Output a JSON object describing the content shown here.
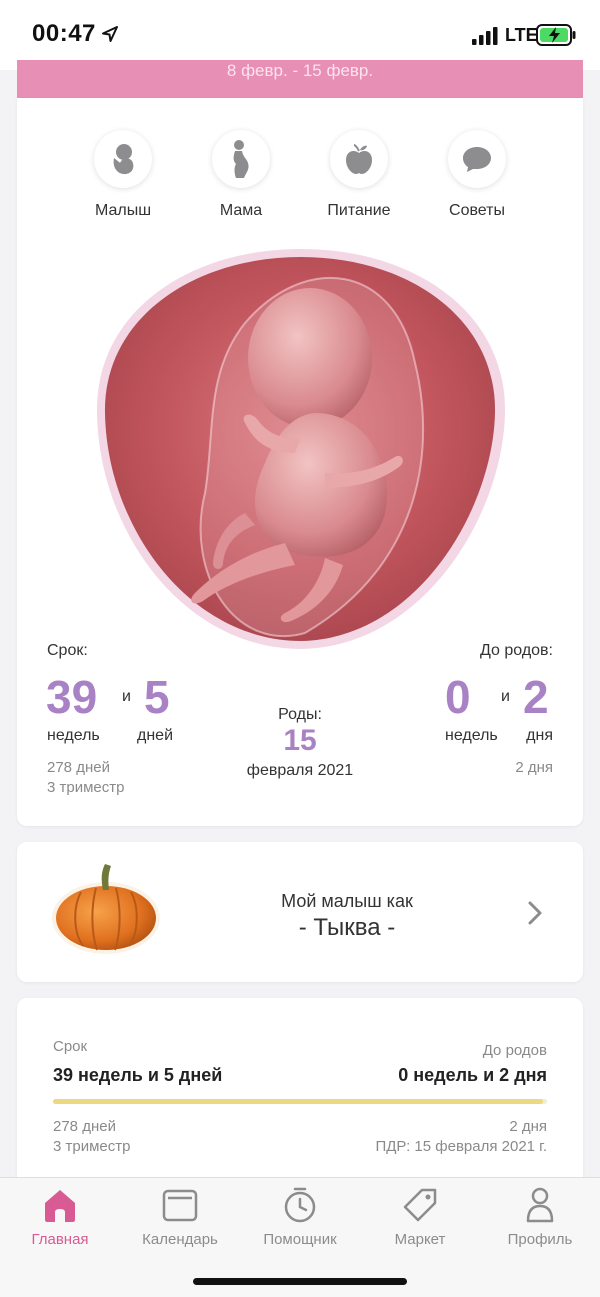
{
  "status": {
    "time": "00:47",
    "network": "LTE",
    "location_icon": "location-arrow-icon",
    "signal_icon": "signal-bars-icon",
    "battery_icon": "battery-charging-icon"
  },
  "week_header": {
    "range": "8 февр. - 15 февр."
  },
  "categories": [
    {
      "label": "Малыш",
      "icon": "baby-icon"
    },
    {
      "label": "Мама",
      "icon": "pregnant-mother-icon"
    },
    {
      "label": "Питание",
      "icon": "apple-icon"
    },
    {
      "label": "Советы",
      "icon": "speech-bubble-icon"
    }
  ],
  "term": {
    "label": "Срок:",
    "weeks": "39",
    "and": "и",
    "days": "5",
    "weeks_unit": "недель",
    "days_unit": "дней",
    "total_days": "278 дней",
    "trimester": "3 триместр"
  },
  "birth": {
    "label": "Роды:",
    "day": "15",
    "month_year": "февраля 2021"
  },
  "until_birth": {
    "label": "До родов:",
    "weeks": "0",
    "and": "и",
    "days": "2",
    "weeks_unit": "недель",
    "days_unit": "дня",
    "total_days": "2 дня"
  },
  "baby_size": {
    "title": "Мой малыш как",
    "fruit": "- Тыква -",
    "icon": "pumpkin-icon"
  },
  "progress": {
    "term_label": "Срок",
    "term_value": "39 недель и 5 дней",
    "until_label": "До родов",
    "until_value": "0 недель и 2 дня",
    "fraction": 0.992,
    "total_days": "278 дней",
    "trimester": "3 триместр",
    "remaining_days": "2 дня",
    "due_date": "ПДР: 15 февраля 2021 г."
  },
  "tabs": [
    {
      "label": "Главная",
      "icon": "home-icon",
      "active": true
    },
    {
      "label": "Календарь",
      "icon": "calendar-icon",
      "active": false
    },
    {
      "label": "Помощник",
      "icon": "stopwatch-icon",
      "active": false
    },
    {
      "label": "Маркет",
      "icon": "tag-icon",
      "active": false
    },
    {
      "label": "Профиль",
      "icon": "person-icon",
      "active": false
    }
  ],
  "colors": {
    "accent_pink": "#d95b94",
    "strip_pink": "#e88fb6",
    "number_purple": "#a882c5",
    "progress_yellow": "#ecd880"
  }
}
